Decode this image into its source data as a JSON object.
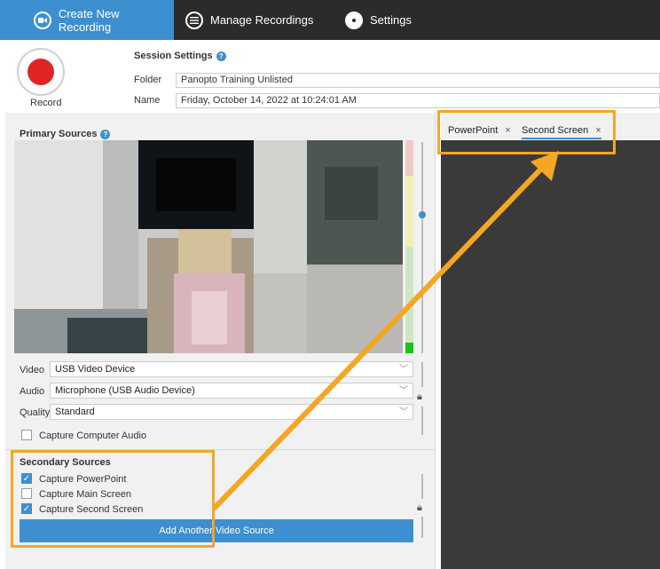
{
  "nav": {
    "tabs": [
      {
        "label": "Create New Recording",
        "icon": "video-camera-icon"
      },
      {
        "label": "Manage Recordings",
        "icon": "list-icon"
      },
      {
        "label": "Settings",
        "icon": "gear-icon"
      }
    ]
  },
  "record": {
    "label": "Record"
  },
  "session": {
    "title": "Session Settings",
    "folder_label": "Folder",
    "folder_value": "Panopto Training Unlisted",
    "name_label": "Name",
    "name_value": "Friday, October 14, 2022 at 10:24:01 AM"
  },
  "primary": {
    "title": "Primary Sources",
    "video_label": "Video",
    "video_value": "USB Video Device",
    "audio_label": "Audio",
    "audio_value": "Microphone (USB Audio Device)",
    "quality_label": "Quality",
    "quality_value": "Standard",
    "capture_computer_audio": "Capture Computer Audio"
  },
  "secondary": {
    "title": "Secondary Sources",
    "items": [
      {
        "label": "Capture PowerPoint",
        "checked": true
      },
      {
        "label": "Capture Main Screen",
        "checked": false
      },
      {
        "label": "Capture Second Screen",
        "checked": true
      }
    ],
    "add_button": "Add Another Video Source"
  },
  "preview_tabs": [
    {
      "label": "PowerPoint",
      "close": "×"
    },
    {
      "label": "Second Screen",
      "close": "×"
    }
  ],
  "colors": {
    "accent": "#3d8fd0",
    "record": "#e12524",
    "highlight": "#f5a623",
    "nav": "#2b2b2b"
  }
}
